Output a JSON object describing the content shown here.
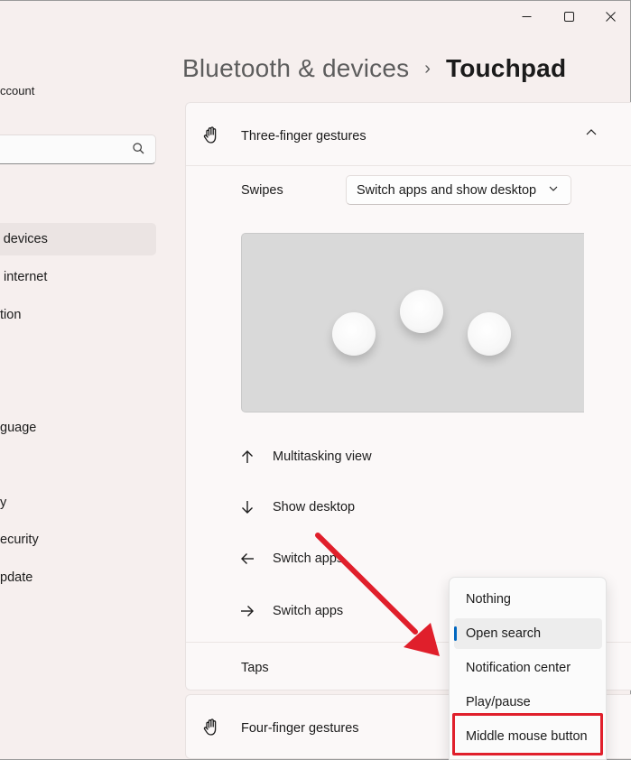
{
  "window": {
    "controls": {
      "minimize": "minimize-icon",
      "maximize": "maximize-icon",
      "close": "close-icon"
    }
  },
  "sidebar": {
    "account_text": "ccount",
    "search": {
      "placeholder": "",
      "icon": "search-icon"
    },
    "items": [
      {
        "label": "& devices",
        "active": true
      },
      {
        "label": "internet",
        "active": false
      },
      {
        "label": "tion",
        "active": false
      },
      {
        "label": "guage",
        "active": false
      },
      {
        "label": "y",
        "active": false
      },
      {
        "label": "ecurity",
        "active": false
      },
      {
        "label": "pdate",
        "active": false
      }
    ]
  },
  "header": {
    "parent": "Bluetooth & devices",
    "separator": "›",
    "current": "Touchpad"
  },
  "three_finger": {
    "title": "Three-finger gestures",
    "icon": "hand-gesture-icon",
    "expanded": true,
    "swipes_label": "Swipes",
    "swipes_value": "Switch apps and show desktop",
    "swipe_actions": [
      {
        "icon": "arrow-up-icon",
        "label": "Multitasking view"
      },
      {
        "icon": "arrow-down-icon",
        "label": "Show desktop"
      },
      {
        "icon": "arrow-left-icon",
        "label": "Switch apps"
      },
      {
        "icon": "arrow-right-icon",
        "label": "Switch apps"
      }
    ],
    "taps_label": "Taps"
  },
  "four_finger": {
    "title": "Four-finger gestures",
    "icon": "hand-gesture-icon"
  },
  "taps_menu": {
    "options": [
      "Nothing",
      "Open search",
      "Notification center",
      "Play/pause",
      "Middle mouse button"
    ],
    "selected": "Open search",
    "highlighted": "Middle mouse button"
  },
  "colors": {
    "accent": "#0067c0",
    "annotation_red": "#e01f2b",
    "background": "#f6efee"
  }
}
